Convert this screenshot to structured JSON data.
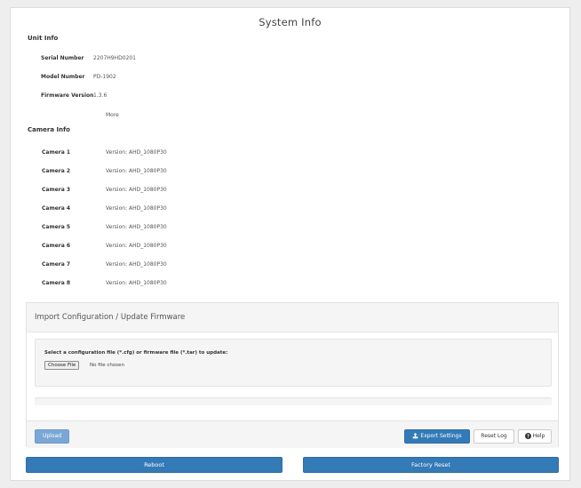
{
  "page": {
    "title": "System Info"
  },
  "unit_info": {
    "title": "Unit Info",
    "rows": [
      {
        "label": "Serial Number",
        "value": "2207H9HD0201"
      },
      {
        "label": "Model Number",
        "value": "PD-1902"
      },
      {
        "label": "Firmware Version",
        "value": "1.3.6"
      }
    ],
    "more_label": "More"
  },
  "camera_info": {
    "title": "Camera Info",
    "rows": [
      {
        "label": "Camera 1",
        "value": "Version: AHD_1080P30"
      },
      {
        "label": "Camera 2",
        "value": "Version: AHD_1080P30"
      },
      {
        "label": "Camera 3",
        "value": "Version: AHD_1080P30"
      },
      {
        "label": "Camera 4",
        "value": "Version: AHD_1080P30"
      },
      {
        "label": "Camera 5",
        "value": "Version: AHD_1080P30"
      },
      {
        "label": "Camera 6",
        "value": "Version: AHD_1080P30"
      },
      {
        "label": "Camera 7",
        "value": "Version: AHD_1080P30"
      },
      {
        "label": "Camera 8",
        "value": "Version: AHD_1080P30"
      }
    ]
  },
  "import": {
    "title": "Import Configuration / Update Firmware",
    "prompt": "Select a configuration file (*.cfg) or firmware file (*.tar) to update:",
    "choose_file_label": "Choose File",
    "file_status": "No file chosen",
    "progress": 0
  },
  "footer_buttons": {
    "upload": "Upload",
    "export_settings": "Export Settings",
    "reset_log": "Reset Log",
    "help": "Help"
  },
  "actions": {
    "reboot": "Reboot",
    "factory_reset": "Factory Reset"
  },
  "colors": {
    "primary": "#337ab7",
    "primary_disabled": "#7aa7d6"
  },
  "icons": {
    "export": "export-icon",
    "help": "question-circle-icon"
  }
}
